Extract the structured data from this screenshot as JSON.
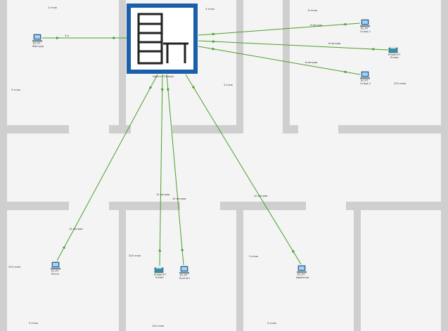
{
  "rooms": [
    {
      "id": "room-1",
      "label": "2 этаж"
    },
    {
      "id": "room-2",
      "label": "3 этаж"
    },
    {
      "id": "room-3",
      "label": "6 этаж"
    },
    {
      "id": "room-4",
      "label": "3 этаж"
    },
    {
      "id": "room-5",
      "label": "3 этаж"
    },
    {
      "id": "room-6",
      "label": "220 этаж"
    },
    {
      "id": "room-7",
      "label": "220 этаж"
    },
    {
      "id": "room-8",
      "label": "320 этаж"
    },
    {
      "id": "room-9",
      "label": "3 этаж"
    },
    {
      "id": "room-10",
      "label": "120 этаж"
    },
    {
      "id": "room-11",
      "label": "3 этаж"
    },
    {
      "id": "room-12",
      "label": "3 этаж"
    },
    {
      "id": "room-13",
      "label": "3 этаж"
    }
  ],
  "switch": {
    "label": "Switch-PT-Empty"
  },
  "devices": [
    {
      "id": "pc-left",
      "type": "pc",
      "label_top": "PC-PT",
      "label_bottom": "Фактура"
    },
    {
      "id": "pc-tr1",
      "type": "pc",
      "label_top": "PC-PT",
      "label_bottom": "Склад 1"
    },
    {
      "id": "printer-tr",
      "type": "printer",
      "label_top": "Printer-PT",
      "label_bottom": "Printer"
    },
    {
      "id": "pc-tr2",
      "type": "pc",
      "label_top": "PC-PT",
      "label_bottom": "Склад 2"
    },
    {
      "id": "pc-bl",
      "type": "pc",
      "label_top": "PC-PT",
      "label_bottom": "Касса"
    },
    {
      "id": "printer-bm",
      "type": "printer",
      "label_top": "Printer-PT",
      "label_bottom": "Printer"
    },
    {
      "id": "pc-bm",
      "type": "pc",
      "label_top": "PC-PT",
      "label_bottom": "Бухгалт"
    },
    {
      "id": "pc-br",
      "type": "pc",
      "label_top": "PC-PT",
      "label_bottom": "Директор"
    }
  ],
  "links": [
    {
      "to": "pc-left",
      "label": "3 м"
    },
    {
      "to": "pc-tr1",
      "label": "6 метров"
    },
    {
      "to": "printer-tr",
      "label": "8 метров"
    },
    {
      "to": "pc-tr2",
      "label": "6 метров"
    },
    {
      "to": "pc-bl",
      "label": "15 метров"
    },
    {
      "to": "printer-bm",
      "label": "10 метров"
    },
    {
      "to": "pc-bm",
      "label": "10 метров"
    },
    {
      "to": "pc-br",
      "label": "10 метров"
    }
  ]
}
